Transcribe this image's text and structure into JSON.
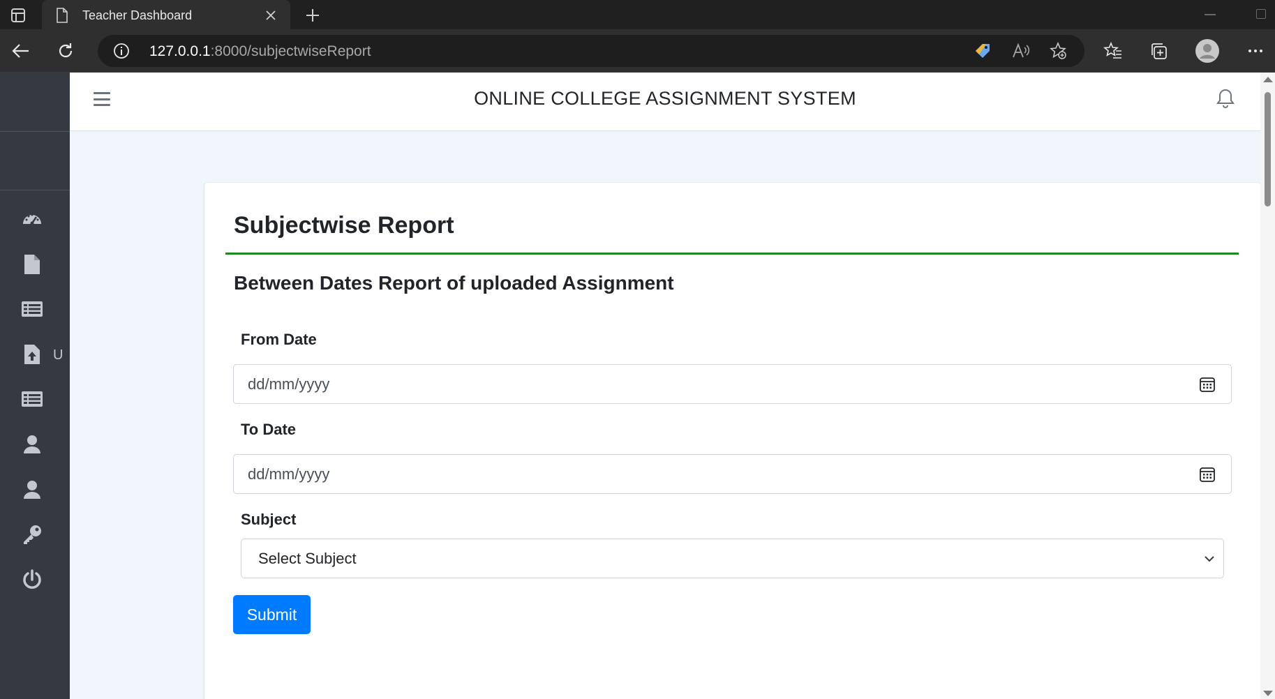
{
  "browser": {
    "tab_title": "Teacher Dashboard",
    "url_host": "127.0.0.1",
    "url_path": ":8000/subjectwiseReport"
  },
  "navbar": {
    "title": "ONLINE COLLEGE ASSIGNMENT SYSTEM"
  },
  "sidebar": {
    "items": [
      {
        "icon": "tachometer-icon"
      },
      {
        "icon": "file-icon"
      },
      {
        "icon": "list-icon"
      },
      {
        "icon": "file-upload-icon",
        "label": "U"
      },
      {
        "icon": "list-icon"
      },
      {
        "icon": "user-icon"
      },
      {
        "icon": "user-icon"
      },
      {
        "icon": "key-icon"
      },
      {
        "icon": "power-icon"
      }
    ]
  },
  "report": {
    "title": "Subjectwise Report",
    "subtitle": "Between Dates Report of uploaded Assignment",
    "from_label": "From Date",
    "from_placeholder": "dd/mm/yyyy",
    "to_label": "To Date",
    "to_placeholder": "dd/mm/yyyy",
    "subject_label": "Subject",
    "subject_value": "Select Subject",
    "submit_label": "Submit"
  },
  "colors": {
    "sidebar_bg": "#343a40",
    "accent_rule": "#1e8a1e",
    "primary_button": "#007bff",
    "page_bg": "#f0f6fc"
  }
}
